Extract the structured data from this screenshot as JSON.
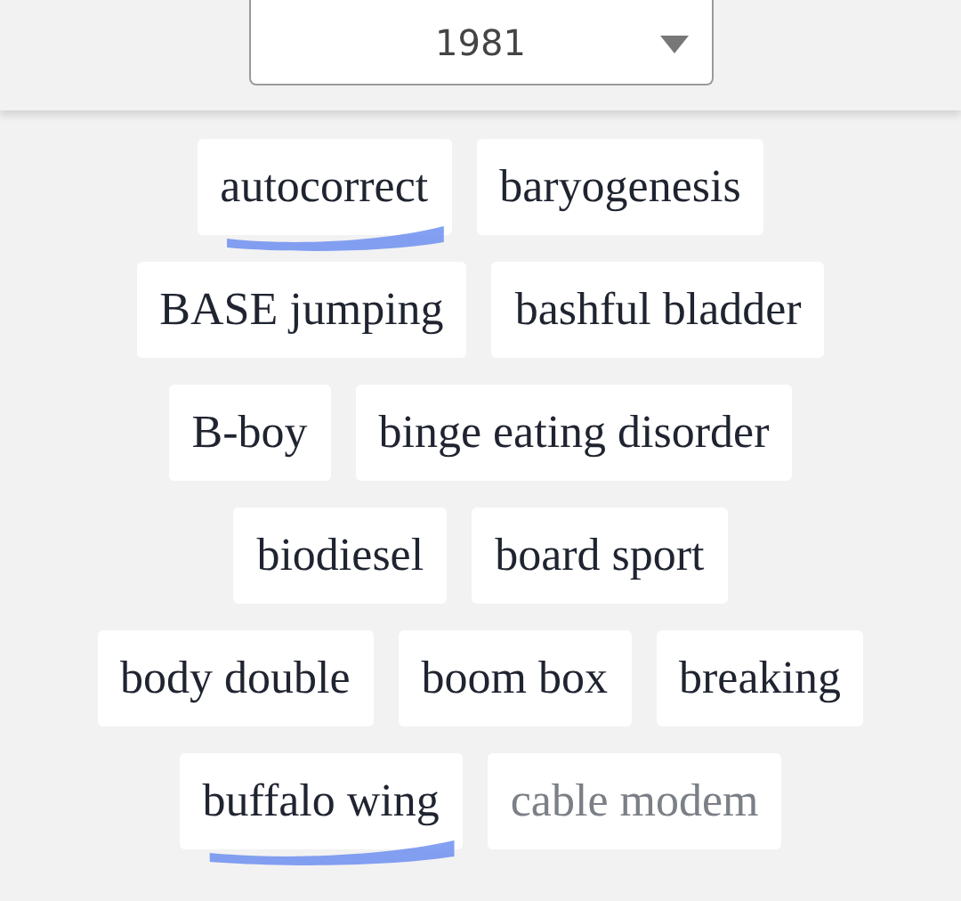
{
  "year_select": {
    "value": "1981"
  },
  "tag_rows": [
    {
      "tags": [
        {
          "label": "autocorrect",
          "highlighted": true,
          "dimmed": false
        },
        {
          "label": "baryogenesis",
          "highlighted": false,
          "dimmed": false
        }
      ]
    },
    {
      "tags": [
        {
          "label": "BASE jumping",
          "highlighted": false,
          "dimmed": false
        },
        {
          "label": "bashful bladder",
          "highlighted": false,
          "dimmed": false
        }
      ]
    },
    {
      "tags": [
        {
          "label": "B-boy",
          "highlighted": false,
          "dimmed": false
        },
        {
          "label": "binge eating disorder",
          "highlighted": false,
          "dimmed": false
        }
      ]
    },
    {
      "tags": [
        {
          "label": "biodiesel",
          "highlighted": false,
          "dimmed": false
        },
        {
          "label": "board sport",
          "highlighted": false,
          "dimmed": false
        }
      ]
    },
    {
      "tags": [
        {
          "label": "body double",
          "highlighted": false,
          "dimmed": false
        },
        {
          "label": "boom box",
          "highlighted": false,
          "dimmed": false
        },
        {
          "label": "breaking",
          "highlighted": false,
          "dimmed": false
        }
      ]
    },
    {
      "tags": [
        {
          "label": "buffalo wing",
          "highlighted": true,
          "dimmed": false
        },
        {
          "label": "cable modem",
          "highlighted": false,
          "dimmed": true
        }
      ]
    }
  ]
}
